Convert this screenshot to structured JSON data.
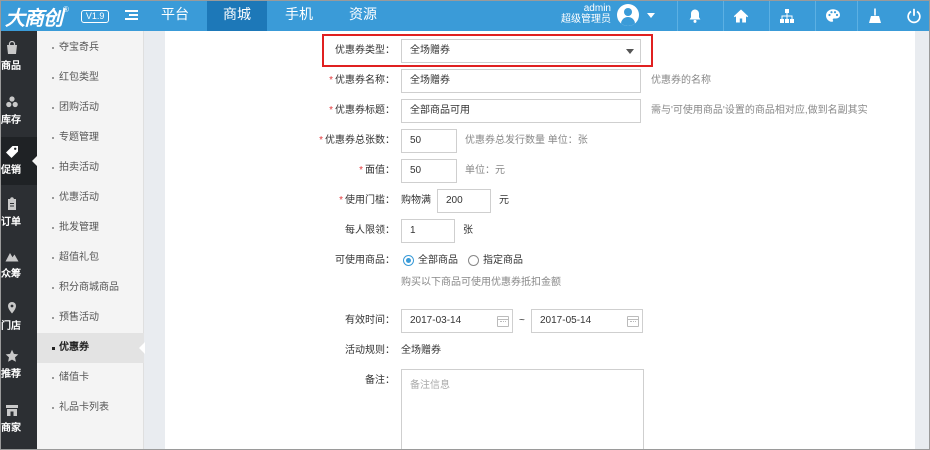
{
  "brand": {
    "name": "大商创",
    "reg": "®",
    "version": "V1.9"
  },
  "topnav": {
    "tabs": [
      {
        "label": "平台",
        "active": false
      },
      {
        "label": "商城",
        "active": true
      },
      {
        "label": "手机",
        "active": false
      },
      {
        "label": "资源",
        "active": false
      }
    ]
  },
  "user": {
    "name": "admin",
    "role": "超级管理员"
  },
  "top_icons": [
    "bell-icon",
    "home-icon",
    "sitemap-icon",
    "palette-icon",
    "broom-icon",
    "power-icon"
  ],
  "colors": {
    "topbar": "#3a9bd8",
    "active_tab": "#1d78b8",
    "sidebar": "#2c2f33",
    "required": "#e4393c",
    "highlight": "#e02020"
  },
  "leftnav": [
    {
      "label": "商品",
      "icon": "bag-icon"
    },
    {
      "label": "库存",
      "icon": "boxes-icon"
    },
    {
      "label": "促销",
      "icon": "tag-icon",
      "active": true
    },
    {
      "label": "订单",
      "icon": "clipboard-icon"
    },
    {
      "label": "众筹",
      "icon": "mountain-icon"
    },
    {
      "label": "门店",
      "icon": "map-pin-icon"
    },
    {
      "label": "推荐",
      "icon": "star-icon"
    },
    {
      "label": "商家",
      "icon": "store-icon"
    }
  ],
  "subnav": [
    {
      "label": "夺宝奇兵"
    },
    {
      "label": "红包类型"
    },
    {
      "label": "团购活动"
    },
    {
      "label": "专题管理"
    },
    {
      "label": "拍卖活动"
    },
    {
      "label": "优惠活动"
    },
    {
      "label": "批发管理"
    },
    {
      "label": "超值礼包"
    },
    {
      "label": "积分商城商品"
    },
    {
      "label": "预售活动"
    },
    {
      "label": "优惠券",
      "active": true
    },
    {
      "label": "储值卡"
    },
    {
      "label": "礼品卡列表"
    }
  ],
  "form": {
    "type": {
      "label": "优惠券类型：",
      "value": "全场赠券"
    },
    "name": {
      "req": "*",
      "label": "优惠券名称：",
      "value": "全场赠券",
      "hint": "优惠券的名称"
    },
    "title": {
      "req": "*",
      "label": "优惠券标题：",
      "value": "全部商品可用",
      "hint": "需与'可使用商品'设置的商品相对应,做到名副其实"
    },
    "total": {
      "req": "*",
      "label": "优惠券总张数：",
      "value": "50",
      "hint": "优惠券总发行数量 单位：张"
    },
    "face": {
      "req": "*",
      "label": "面值：",
      "value": "50",
      "hint": "单位：元"
    },
    "threshold": {
      "req": "*",
      "label": "使用门槛：",
      "prefix": "购物满",
      "value": "200",
      "suffix": "元"
    },
    "limit": {
      "label": "每人限领：",
      "value": "1",
      "suffix": "张"
    },
    "usable": {
      "label": "可使用商品：",
      "option_all": "全部商品",
      "option_some": "指定商品",
      "selected": "全部商品",
      "note": "购买以下商品可使用优惠券抵扣金额"
    },
    "valid": {
      "label": "有效时间：",
      "start": "2017-03-14",
      "sep": "~",
      "end": "2017-05-14"
    },
    "rule": {
      "label": "活动规则：",
      "value": "全场赠券"
    },
    "remark": {
      "label": "备注：",
      "placeholder": "备注信息"
    }
  }
}
